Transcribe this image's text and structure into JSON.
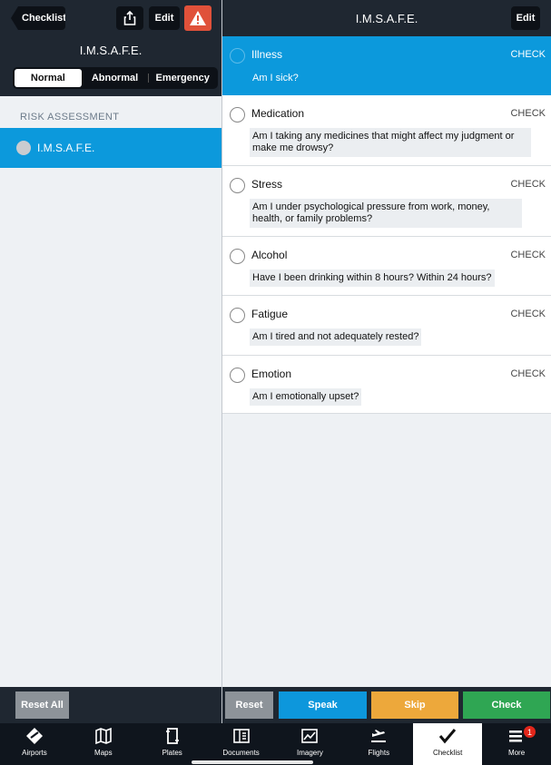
{
  "left": {
    "back_label": "Checklist",
    "edit_label": "Edit",
    "title": "I.M.S.A.F.E.",
    "segments": [
      "Normal",
      "Abnormal",
      "Emergency"
    ],
    "section_header": "RISK ASSESSMENT",
    "selected_row": "I.M.S.A.F.E.",
    "reset_all_label": "Reset All"
  },
  "right": {
    "title": "I.M.S.A.F.E.",
    "edit_label": "Edit",
    "items": [
      {
        "name": "Illness",
        "action": "CHECK",
        "desc": "Am I sick?"
      },
      {
        "name": "Medication",
        "action": "CHECK",
        "desc": "Am I taking any medicines that might affect my judgment or make me drowsy?"
      },
      {
        "name": "Stress",
        "action": "CHECK",
        "desc": "Am I under psychological pressure from work, money, health, or family problems?"
      },
      {
        "name": "Alcohol",
        "action": "CHECK",
        "desc": "Have I been drinking within 8 hours? Within 24 hours?"
      },
      {
        "name": "Fatigue",
        "action": "CHECK",
        "desc": "Am I tired and not adequately rested?"
      },
      {
        "name": "Emotion",
        "action": "CHECK",
        "desc": "Am I emotionally upset?"
      }
    ],
    "buttons": {
      "reset": "Reset",
      "speak": "Speak",
      "skip": "Skip",
      "check": "Check"
    }
  },
  "tabbar": {
    "tabs": [
      {
        "label": "Airports",
        "icon": "airport-icon"
      },
      {
        "label": "Maps",
        "icon": "map-icon"
      },
      {
        "label": "Plates",
        "icon": "plates-icon"
      },
      {
        "label": "Documents",
        "icon": "documents-icon"
      },
      {
        "label": "Imagery",
        "icon": "imagery-icon"
      },
      {
        "label": "Flights",
        "icon": "flights-icon"
      },
      {
        "label": "Checklist",
        "icon": "checklist-icon"
      },
      {
        "label": "More",
        "icon": "more-icon"
      }
    ],
    "more_badge": "1"
  },
  "colors": {
    "accent": "#0c99dc",
    "warning": "#e0513a",
    "speak": "#0d97dc",
    "skip": "#eda83b",
    "check": "#2fa653",
    "reset": "#8d9399"
  }
}
